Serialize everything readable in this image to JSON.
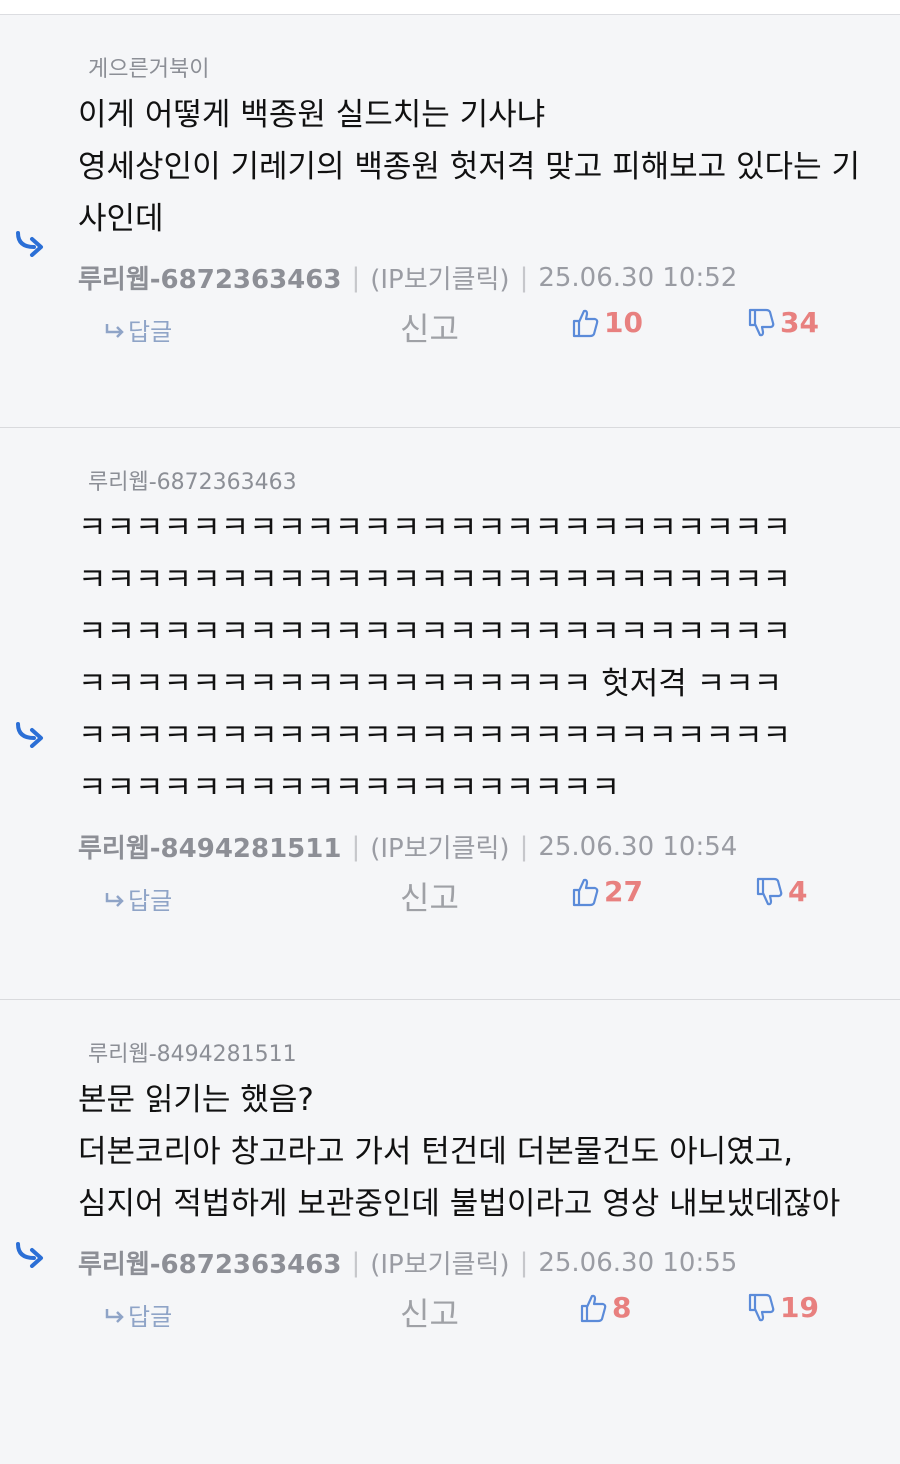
{
  "comments": [
    {
      "reply_to": "게으른거북이",
      "body": "이게 어떻게 백종원 실드치는 기사냐\n영세상인이 기레기의 백종원 헛저격 맞고 피해보고 있다는 기사인데",
      "author": "루리웹-6872363463",
      "ip_label": "(IP보기클릭)",
      "timestamp": "25.06.30 10:52",
      "reply_label": "답글",
      "report_label": "신고",
      "likes": "10",
      "dislikes": "34"
    },
    {
      "reply_to": "루리웹-6872363463",
      "body": "ㅋㅋㅋㅋㅋㅋㅋㅋㅋㅋㅋㅋㅋㅋㅋㅋㅋㅋㅋㅋㅋㅋㅋㅋㅋ\nㅋㅋㅋㅋㅋㅋㅋㅋㅋㅋㅋㅋㅋㅋㅋㅋㅋㅋㅋㅋㅋㅋㅋㅋㅋ\nㅋㅋㅋㅋㅋㅋㅋㅋㅋㅋㅋㅋㅋㅋㅋㅋㅋㅋㅋㅋㅋㅋㅋㅋㅋ\nㅋㅋㅋㅋㅋㅋㅋㅋㅋㅋㅋㅋㅋㅋㅋㅋㅋㅋ 헛저격 ㅋㅋㅋ\nㅋㅋㅋㅋㅋㅋㅋㅋㅋㅋㅋㅋㅋㅋㅋㅋㅋㅋㅋㅋㅋㅋㅋㅋㅋ\nㅋㅋㅋㅋㅋㅋㅋㅋㅋㅋㅋㅋㅋㅋㅋㅋㅋㅋㅋ",
      "author": "루리웹-8494281511",
      "ip_label": "(IP보기클릭)",
      "timestamp": "25.06.30 10:54",
      "reply_label": "답글",
      "report_label": "신고",
      "likes": "27",
      "dislikes": "4"
    },
    {
      "reply_to": "루리웹-8494281511",
      "body": "본문 읽기는 했음?\n더본코리아 창고라고 가서 턴건데 더본물건도 아니였고,\n심지어 적법하게 보관중인데 불법이라고 영상 내보냈데잖아",
      "author": "루리웹-6872363463",
      "ip_label": "(IP보기클릭)",
      "timestamp": "25.06.30 10:55",
      "reply_label": "답글",
      "report_label": "신고",
      "likes": "8",
      "dislikes": "19"
    }
  ],
  "colors": {
    "background": "#f5f6f8",
    "reply_arrow": "#2b6fd6",
    "vote": "#e8807f",
    "thumb_icon": "#5b8bd9"
  },
  "icons": [
    "reply-arrow-icon",
    "reply-small-arrow-icon",
    "thumbs-up-icon",
    "thumbs-down-icon"
  ]
}
